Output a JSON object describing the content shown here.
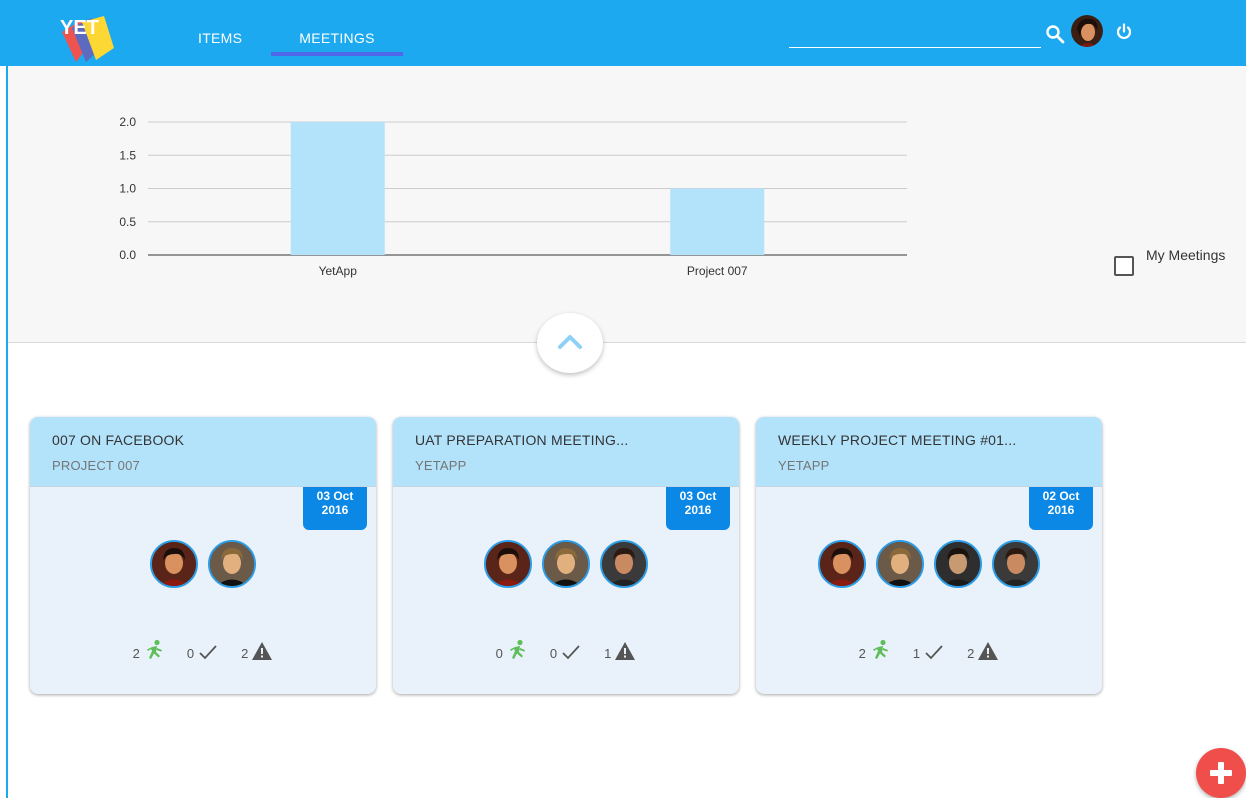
{
  "nav": {
    "logo_text": "YET",
    "tabs": [
      {
        "label": "ITEMS",
        "active": false
      },
      {
        "label": "MEETINGS",
        "active": true
      }
    ],
    "search_placeholder": "",
    "accent": "#1da9f0"
  },
  "chart_data": {
    "type": "bar",
    "categories": [
      "YetApp",
      "Project 007"
    ],
    "values": [
      2,
      1
    ],
    "ylim": [
      0,
      2
    ],
    "yticks": [
      "0.0",
      "0.5",
      "1.0",
      "1.5",
      "2.0"
    ],
    "grid": true,
    "bar_color": "#b3e3fb"
  },
  "filter": {
    "my_meetings_label": "My Meetings",
    "my_meetings_checked": false
  },
  "meetings": [
    {
      "title": "007 ON FACEBOOK",
      "project": "PROJECT 007",
      "date_day": "03 Oct",
      "date_year": "2016",
      "attendees": [
        "avatar-1",
        "avatar-2"
      ],
      "actions": "2",
      "done": "0",
      "issues": "2"
    },
    {
      "title": "UAT PREPARATION MEETING...",
      "project": "YETAPP",
      "date_day": "03 Oct",
      "date_year": "2016",
      "attendees": [
        "avatar-1",
        "avatar-2",
        "avatar-3"
      ],
      "actions": "0",
      "done": "0",
      "issues": "1"
    },
    {
      "title": "WEEKLY PROJECT MEETING #01...",
      "project": "YETAPP",
      "date_day": "02 Oct",
      "date_year": "2016",
      "attendees": [
        "avatar-1",
        "avatar-2",
        "avatar-4",
        "avatar-3"
      ],
      "actions": "2",
      "done": "1",
      "issues": "2"
    }
  ],
  "icons": {
    "search": "search-icon",
    "power": "power-icon",
    "collapse": "chevron-up-icon",
    "action": "running-person-icon",
    "done": "checkmark-icon",
    "issue": "warning-icon",
    "add": "plus-icon"
  }
}
